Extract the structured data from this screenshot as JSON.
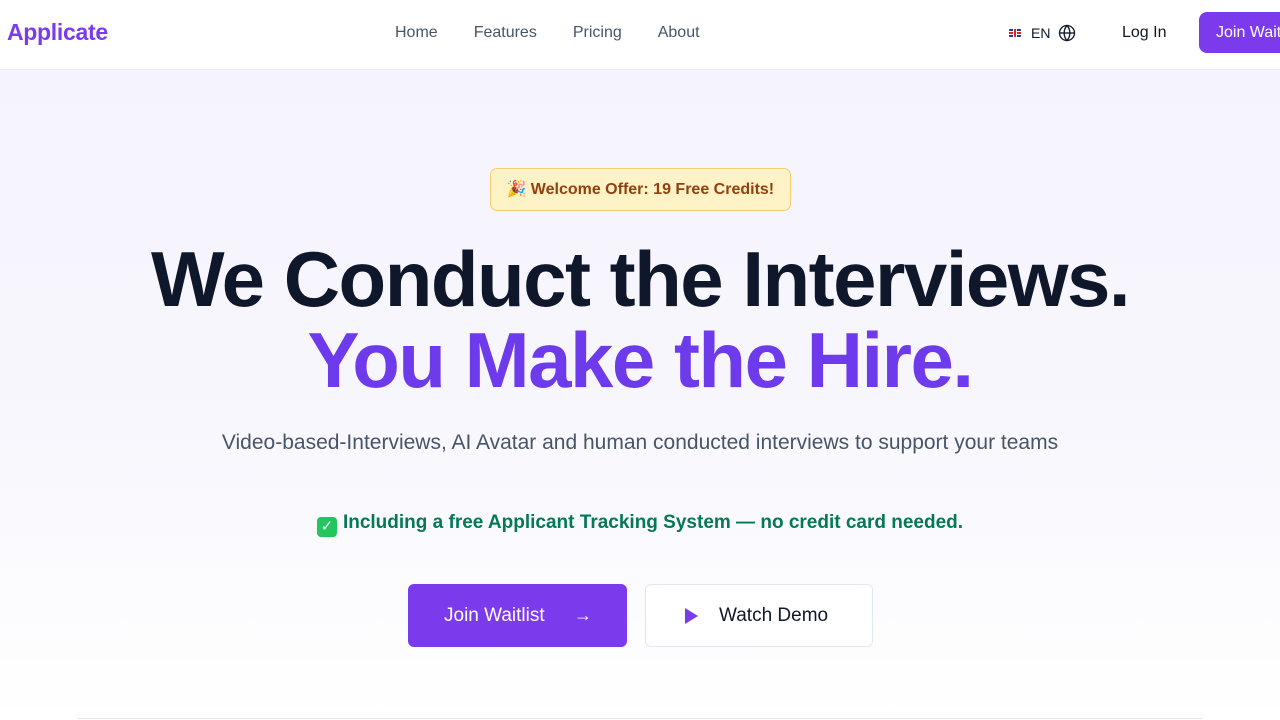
{
  "header": {
    "logo": "Applicate",
    "nav": [
      "Home",
      "Features",
      "Pricing",
      "About"
    ],
    "language": {
      "code": "EN",
      "flag_icon": "uk-flag-icon",
      "globe_icon": "globe-icon"
    },
    "login_label": "Log In",
    "join_label": "Join Waitlist"
  },
  "hero": {
    "offer": {
      "emoji": "🎉",
      "text": "Welcome Offer: 19 Free Credits!"
    },
    "headline_line1": "We Conduct the Interviews.",
    "headline_line2": "You Make the Hire.",
    "subtitle": "Video-based-Interviews, AI Avatar and human conducted interviews to support your teams",
    "ats_note": {
      "check": "✓",
      "text": "Including a free Applicant Tracking System — no credit card needed."
    },
    "primary_button": {
      "label": "Join Waitlist",
      "arrow": "→"
    },
    "secondary_button": {
      "label": "Watch Demo",
      "icon": "play-icon"
    }
  },
  "colors": {
    "brand": "#7c3aed",
    "headline": "#0f172a",
    "accent_headline": "#6d3bec",
    "ats_green": "#047857",
    "offer_bg": "#fdf3c7",
    "offer_text": "#92400e"
  }
}
